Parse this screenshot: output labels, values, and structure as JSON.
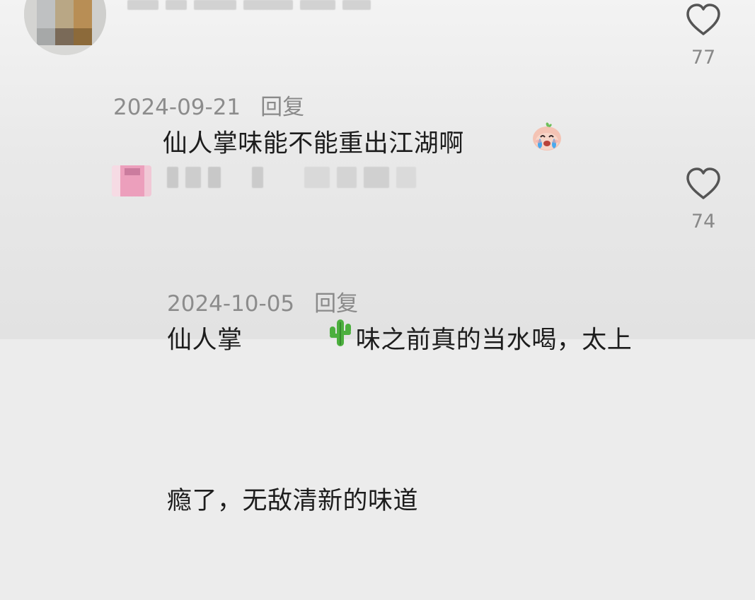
{
  "comments": [
    {
      "text": "仙人掌味能不能重出江湖啊",
      "emoji": "crying-face-emoji",
      "date": "2024-09-21",
      "reply_label": "回复",
      "likes": "77"
    },
    {
      "text_before": "仙人掌",
      "emoji": "cactus-emoji",
      "text_after_line1": "味之前真的当水喝，太上",
      "text_line2": "瘾了，无敌清新的味道",
      "date": "2024-10-05",
      "reply_label": "回复",
      "likes": "74"
    }
  ],
  "colors": {
    "text": "#1d1d1d",
    "meta": "#8c8c8c",
    "icon": "#555555"
  }
}
